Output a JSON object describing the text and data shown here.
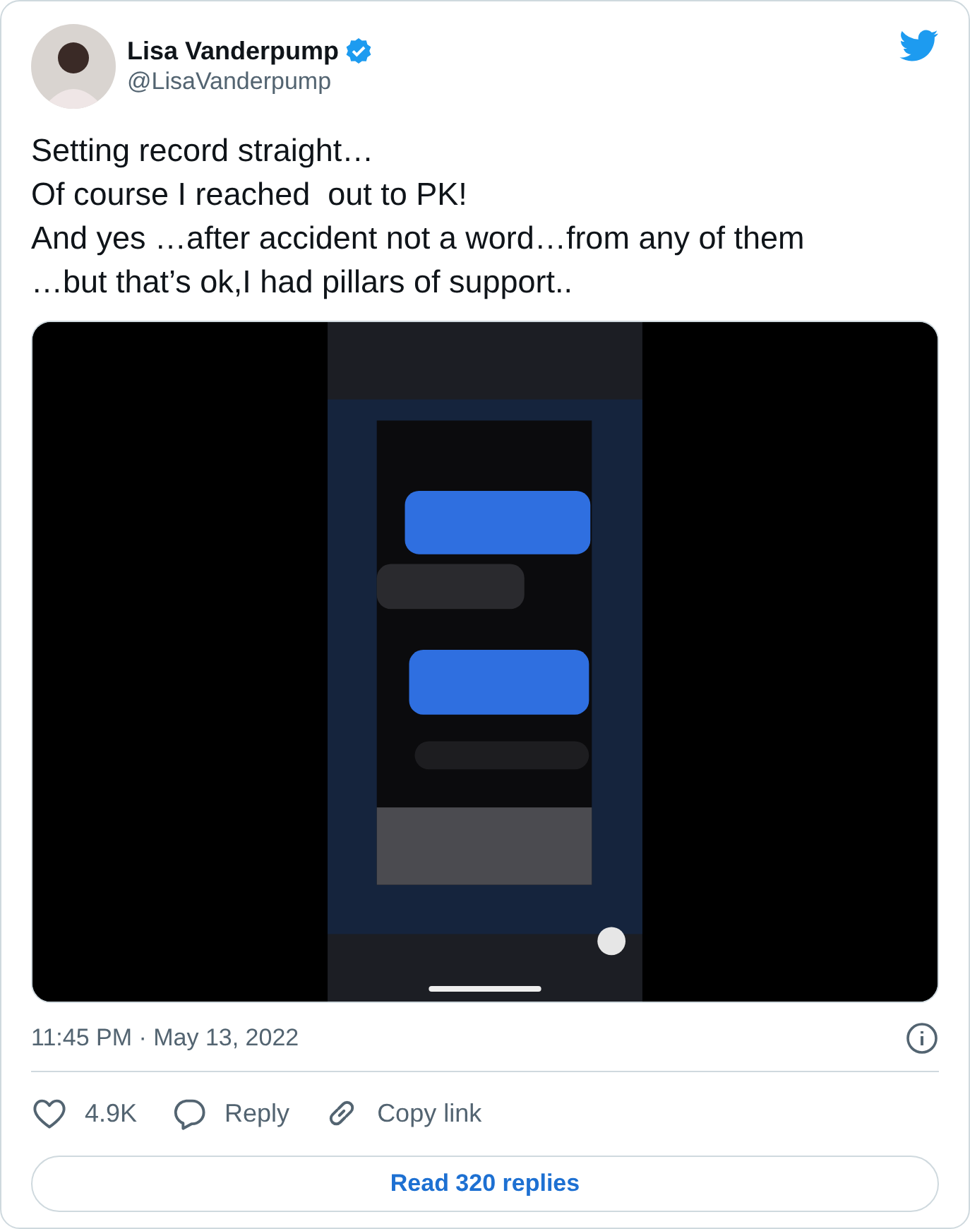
{
  "author": {
    "name": "Lisa Vanderpump",
    "handle": "@LisaVanderpump"
  },
  "text_lines": [
    "Setting record straight…",
    "Of course I reached  out to PK!",
    "And yes …after accident not a word…from any of them",
    "…but that’s ok,I had pillars of support.."
  ],
  "timestamp": "11:45 PM · May 13, 2022",
  "actions": [
    {
      "kind": "like",
      "label": "4.9K"
    },
    {
      "kind": "reply",
      "label": "Reply"
    },
    {
      "kind": "copy",
      "label": "Copy link"
    }
  ],
  "read_replies": "Read 320 replies"
}
